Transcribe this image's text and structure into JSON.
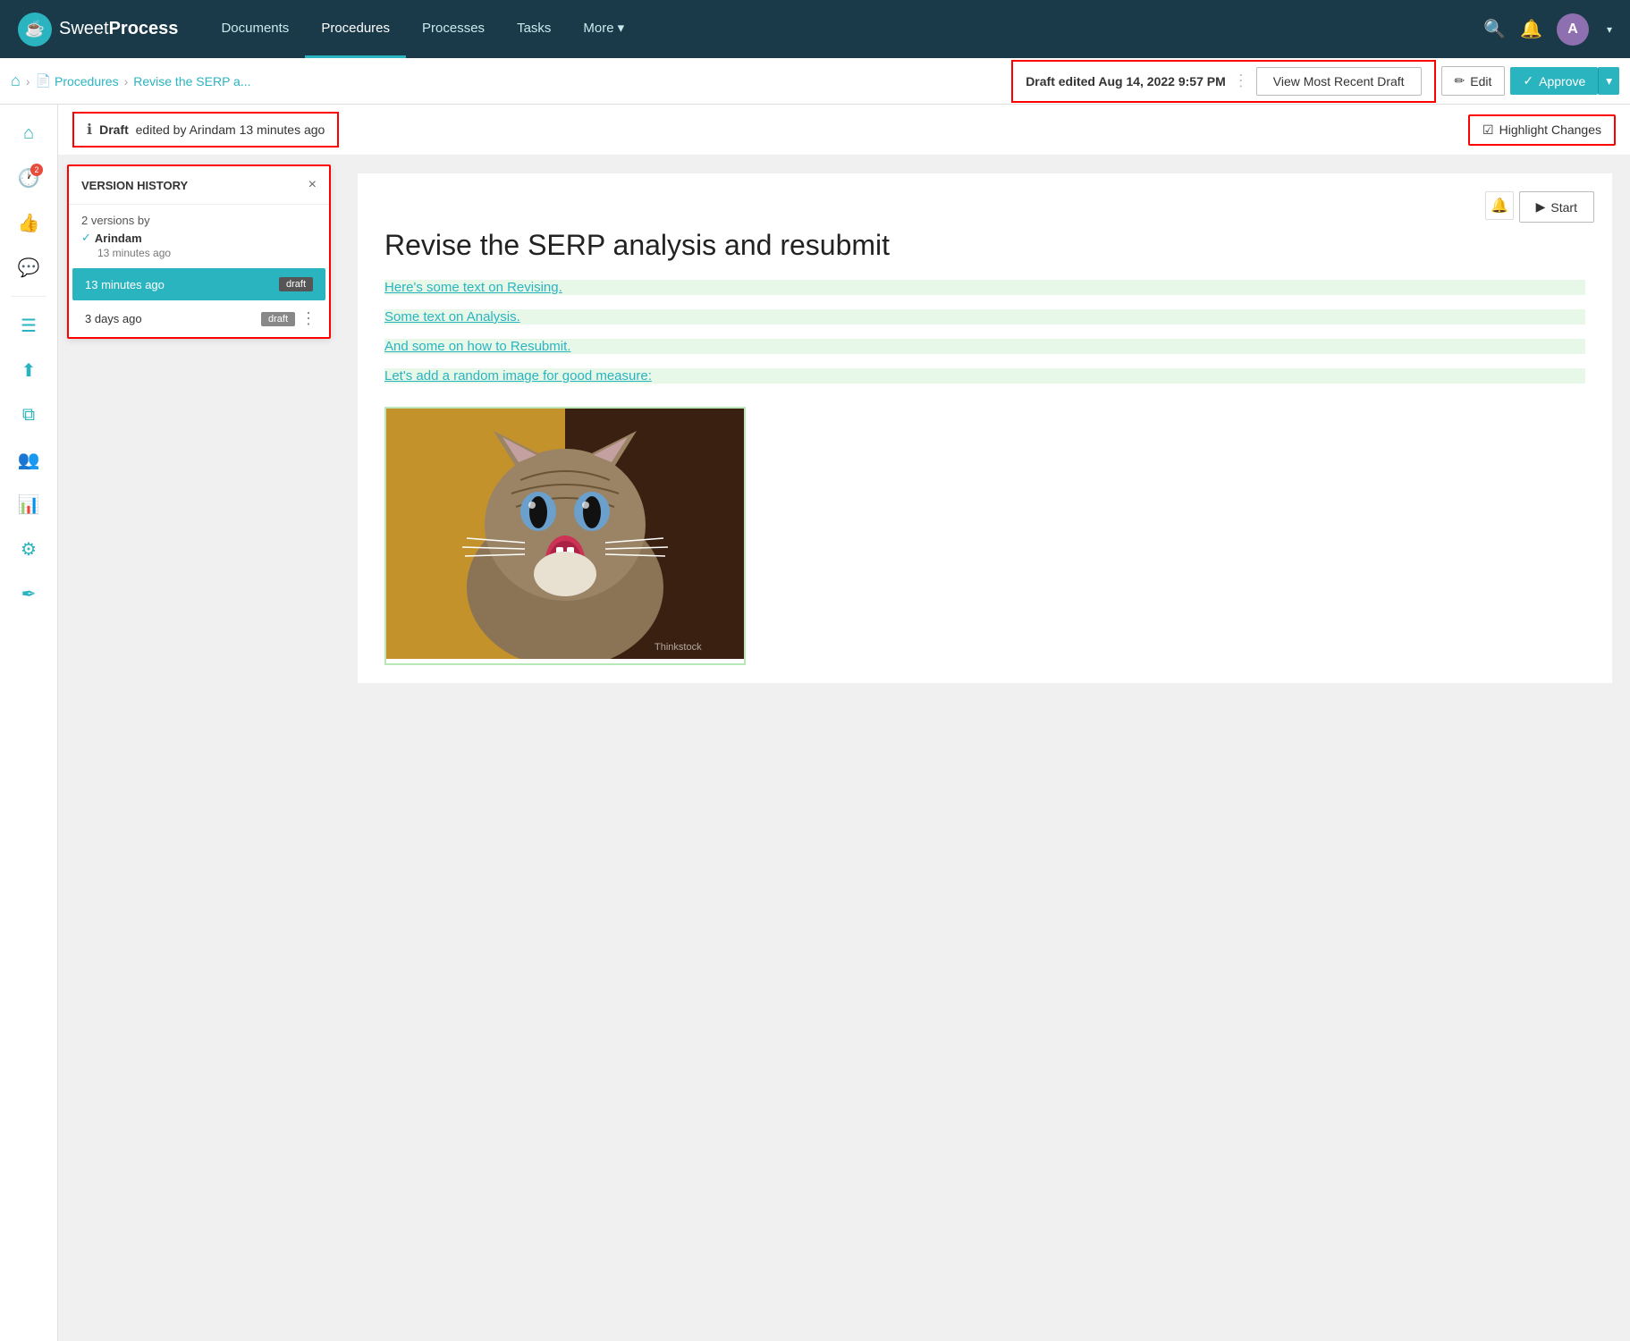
{
  "brand": {
    "name_plain": "Sweet",
    "name_bold": "Process",
    "icon": "☕"
  },
  "nav": {
    "links": [
      {
        "label": "Documents",
        "active": false
      },
      {
        "label": "Procedures",
        "active": true
      },
      {
        "label": "Processes",
        "active": false
      },
      {
        "label": "Tasks",
        "active": false
      },
      {
        "label": "More",
        "active": false,
        "has_dropdown": true
      }
    ],
    "avatar_letter": "A"
  },
  "breadcrumb": {
    "home_icon": "🏠",
    "items": [
      {
        "label": "Procedures",
        "is_link": true
      },
      {
        "label": "Revise the SERP a...",
        "is_link": true
      }
    ]
  },
  "draft_bar": {
    "timestamp": "Draft edited Aug 14, 2022 9:57 PM",
    "view_recent_label": "View Most Recent Draft",
    "edit_label": "Edit",
    "edit_icon": "✏️",
    "approve_label": "Approve",
    "approve_icon": "✓"
  },
  "info_bar": {
    "icon": "ℹ",
    "draft_label": "Draft",
    "text": "edited by Arindam 13 minutes ago"
  },
  "highlight_btn": {
    "label": "Highlight Changes",
    "icon": "☑"
  },
  "version_history": {
    "title": "VERSION HISTORY",
    "author_count": "2 versions by",
    "author_name": "Arindam",
    "author_time": "13 minutes ago",
    "versions": [
      {
        "time": "13 minutes ago",
        "badge": "draft",
        "active": true
      },
      {
        "time": "3 days ago",
        "badge": "draft",
        "active": false,
        "has_menu": true
      }
    ]
  },
  "procedure": {
    "title": "Revise the SERP analysis and resubmit",
    "start_label": "Start",
    "links": [
      "Here's some text on Revising.",
      "Some text on Analysis.",
      "And some on how to Resubmit.",
      "Let's add a random image for good measure:"
    ],
    "image_watermark": "Thinkstock"
  },
  "sidebar_icons": [
    {
      "name": "home-icon",
      "symbol": "🏠"
    },
    {
      "name": "clock-icon",
      "symbol": "🕐",
      "badge": "2"
    },
    {
      "name": "thumbs-up-icon",
      "symbol": "👍"
    },
    {
      "name": "comment-icon",
      "symbol": "💬"
    },
    {
      "name": "list-icon",
      "symbol": "☰"
    },
    {
      "name": "upload-icon",
      "symbol": "⬆"
    },
    {
      "name": "copy-icon",
      "symbol": "⧉"
    },
    {
      "name": "users-icon",
      "symbol": "👥"
    },
    {
      "name": "chart-icon",
      "symbol": "📊"
    },
    {
      "name": "gear-icon",
      "symbol": "⚙"
    },
    {
      "name": "signature-icon",
      "symbol": "✒"
    }
  ]
}
